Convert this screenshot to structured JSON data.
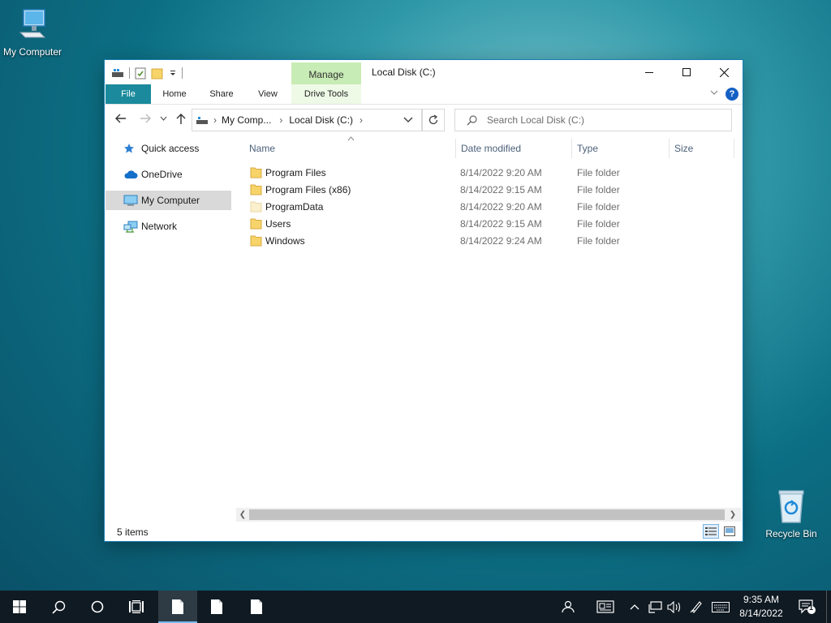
{
  "desktop": {
    "icons": [
      {
        "label": "My Computer"
      },
      {
        "label": "Recycle Bin"
      }
    ]
  },
  "window": {
    "title": "Local Disk (C:)",
    "context_tab_group": "Manage",
    "ribbon_tabs": [
      "File",
      "Home",
      "Share",
      "View",
      "Drive Tools"
    ],
    "address": {
      "crumbs": [
        "My Comp...",
        "Local Disk (C:)"
      ]
    },
    "search_placeholder": "Search Local Disk (C:)",
    "nav": [
      {
        "label": "Quick access",
        "icon": "star-icon"
      },
      {
        "label": "OneDrive",
        "icon": "cloud-icon"
      },
      {
        "label": "My Computer",
        "icon": "computer-icon",
        "selected": true
      },
      {
        "label": "Network",
        "icon": "network-icon"
      }
    ],
    "columns": [
      "Name",
      "Date modified",
      "Type",
      "Size"
    ],
    "files": [
      {
        "name": "Program Files",
        "date": "8/14/2022 9:20 AM",
        "type": "File folder"
      },
      {
        "name": "Program Files (x86)",
        "date": "8/14/2022 9:15 AM",
        "type": "File folder"
      },
      {
        "name": "ProgramData",
        "date": "8/14/2022 9:20 AM",
        "type": "File folder"
      },
      {
        "name": "Users",
        "date": "8/14/2022 9:15 AM",
        "type": "File folder"
      },
      {
        "name": "Windows",
        "date": "8/14/2022 9:24 AM",
        "type": "File folder"
      }
    ],
    "status": "5 items"
  },
  "taskbar": {
    "time": "9:35 AM",
    "date": "8/14/2022",
    "notification_count": "1",
    "accent": "#76b9ed"
  }
}
